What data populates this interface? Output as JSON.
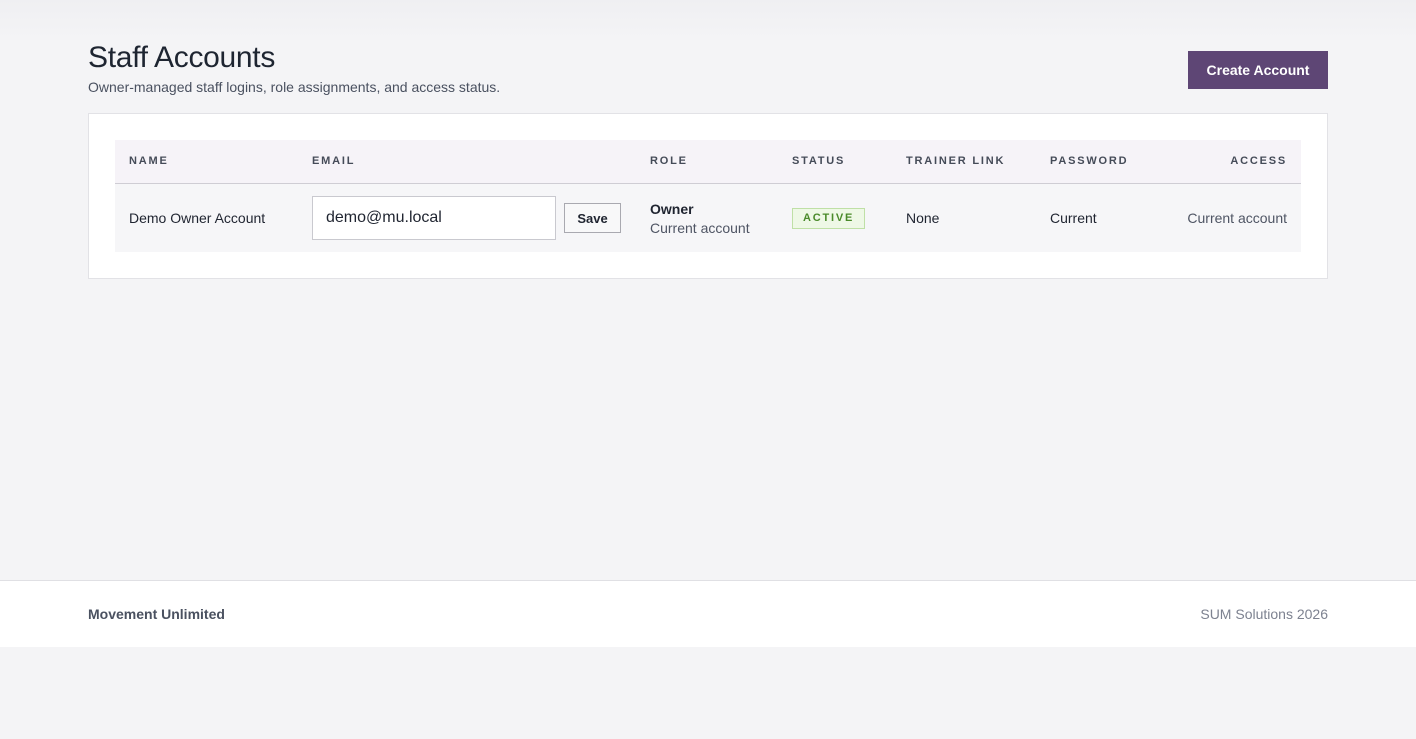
{
  "header": {
    "title": "Staff Accounts",
    "subtitle": "Owner-managed staff logins, role assignments, and access status.",
    "create_label": "Create Account"
  },
  "table": {
    "columns": {
      "name": "NAME",
      "email": "EMAIL",
      "role": "ROLE",
      "status": "STATUS",
      "trainer": "TRAINER LINK",
      "password": "PASSWORD",
      "access": "ACCESS"
    },
    "rows": [
      {
        "name": "Demo Owner Account",
        "email": "demo@mu.local",
        "save_label": "Save",
        "role": "Owner",
        "role_note": "Current account",
        "status": "ACTIVE",
        "trainer": "None",
        "password": "Current",
        "access": "Current account"
      }
    ]
  },
  "footer": {
    "brand": "Movement Unlimited",
    "copyright": "SUM Solutions 2026"
  },
  "colors": {
    "accent": "#5e4675",
    "status_active_bg": "#eef8e6",
    "status_active_text": "#4a8a2a"
  }
}
